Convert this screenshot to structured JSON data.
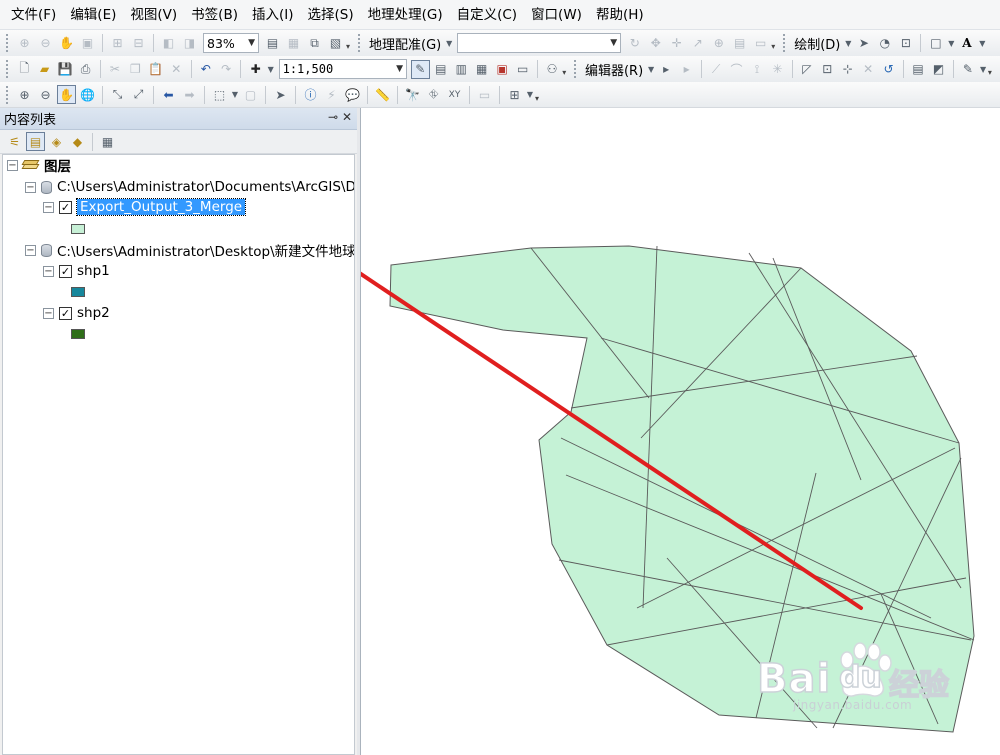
{
  "menu": [
    "文件(F)",
    "编辑(E)",
    "视图(V)",
    "书签(B)",
    "插入(I)",
    "选择(S)",
    "地理处理(G)",
    "自定义(C)",
    "窗口(W)",
    "帮助(H)"
  ],
  "toolbar": {
    "zoom_value": "83%",
    "georef_label": "地理配准(G)",
    "georef_layer_value": "",
    "draw_label": "绘制(D)",
    "font_label": "A",
    "scale_value": "1:1,500",
    "editor_label": "编辑器(R)"
  },
  "toc": {
    "title": "内容列表",
    "pin": "⊸",
    "close": "✕",
    "root_label": "图层",
    "group1": {
      "path": "C:\\Users\\Administrator\\Documents\\ArcGIS\\D",
      "layer": {
        "name": "Export_Output_3_Merge",
        "checked": "✓",
        "color": "#c7f0d6"
      }
    },
    "group2": {
      "path": "C:\\Users\\Administrator\\Desktop\\新建文件地球",
      "layers": [
        {
          "name": "shp1",
          "checked": "✓",
          "color": "#16879c"
        },
        {
          "name": "shp2",
          "checked": "✓",
          "color": "#2f6e19"
        }
      ]
    }
  },
  "map": {
    "polygon_fill": "#c5f2d6",
    "line_color": "#5a5a5a",
    "arrow_color": "#e01f1f"
  },
  "watermark": {
    "brand": "Bai",
    "brand2": "du",
    "cn": "经验",
    "url": "jingyan.baidu.com"
  }
}
